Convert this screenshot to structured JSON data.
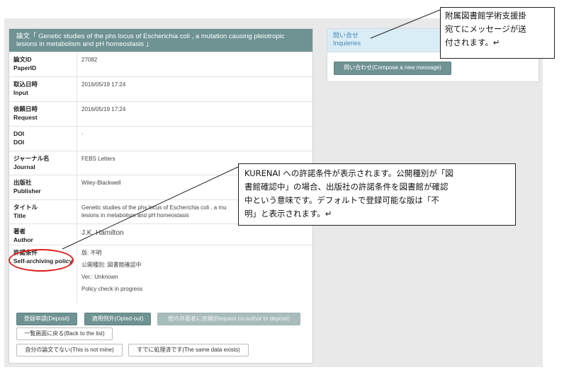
{
  "paper": {
    "title_line1": "論文「 Genetic studies of the phs locus of Escherichia coli , a mutation causing pleiotropic",
    "title_line2": "lesions in metabolism and pH homeostasis 」"
  },
  "fields": {
    "paperid": {
      "label_ja": "論文ID",
      "label_en": "PaperID",
      "value": "27082"
    },
    "input": {
      "label_ja": "取込日時",
      "label_en": "Input",
      "value": "2016/05/19 17:24"
    },
    "request": {
      "label_ja": "依頼日時",
      "label_en": "Request",
      "value": "2016/05/19 17:24"
    },
    "doi": {
      "label_ja": "DOI",
      "label_en": "DOI",
      "value": "·"
    },
    "journal": {
      "label_ja": "ジャーナル名",
      "label_en": "Journal",
      "value": "FEBS Letters"
    },
    "publisher": {
      "label_ja": "出版社",
      "label_en": "Publisher",
      "value": "Wiley-Blackwell"
    },
    "title": {
      "label_ja": "タイトル",
      "label_en": "Title",
      "value_line1": "Genetic studies of the phs locus of Escherichia coli , a mu",
      "value_line2": "lesions in metabolism and pH homeostasis"
    },
    "author": {
      "label_ja": "著者",
      "label_en": "Author",
      "value": "J.K. Hamilton"
    },
    "policy": {
      "label_ja": "許諾条件",
      "label_en": "Self-archiving policy",
      "line1": "版: 不明",
      "line2": "公開種別: 図書館確認中",
      "line3": "Ver.: Unknown",
      "line4": "Policy check in progress"
    }
  },
  "buttons": {
    "deposit": "登録申請(Deposit)",
    "opted_out": "適用例外(Opted-out)",
    "request_coauthor": "他の共著者に依頼(Request co-author to deposit)",
    "back_to_list": "一覧画面に戻る(Back to the list)",
    "not_mine": "自分の論文でない(This is not mine)",
    "same_data": "すでに処理済です(The same data exists)"
  },
  "inquiries": {
    "title_ja": "問い合せ",
    "title_en": "Inquieries",
    "compose_button": "問い合わせ(Compose a new message)"
  },
  "callouts": {
    "top_line1": "附属図書館学術支援掛",
    "top_line2": "宛てにメッセージが送",
    "top_line3": "付されます。↵",
    "mid_line1": "KURENAI への許諾条件が表示されます。公開種別が「図",
    "mid_line2": "書館確認中」の場合、出版社の許諾条件を図書館が確認",
    "mid_line3": "中という意味です。デフォルトで登録可能な版は「不",
    "mid_line4": "明」と表示されます。↵"
  },
  "colors": {
    "header_bg": "#6f9292",
    "primary_button": "#6f9292",
    "inquiry_header": "#d9edf7",
    "highlight": "#e02020"
  }
}
